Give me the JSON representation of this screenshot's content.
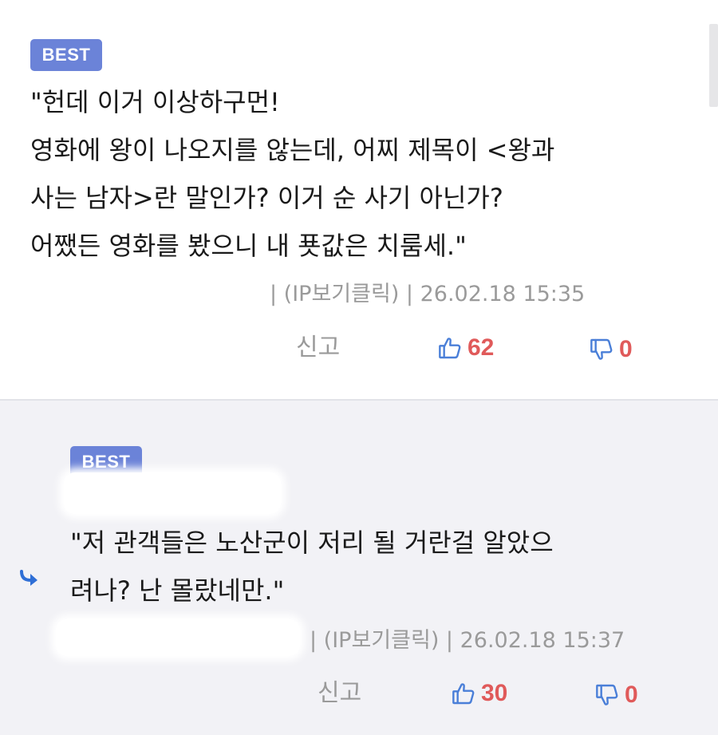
{
  "comments": [
    {
      "badge": "BEST",
      "text": "\"헌데 이거 이상하구먼!\n 영화에 왕이 나오지를 않는데, 어찌 제목이 <왕과\n사는 남자>란 말인가? 이거 순 사기 아닌가?\n 어쨌든 영화를 봤으니 내 푯값은 치룸세.\"",
      "meta": "| (IP보기클릭) | 26.02.18 15:35",
      "report": "신고",
      "likes": "62",
      "dislikes": "0"
    },
    {
      "badge": "BEST",
      "text": "\"저 관객들은 노산군이 저리 될 거란걸 알았으\n려나? 난 몰랐네만.\"",
      "meta": "| (IP보기클릭) | 26.02.18 15:37",
      "report": "신고",
      "likes": "30",
      "dislikes": "0"
    }
  ],
  "icons": {
    "thumbs_up": "thumbs-up-icon",
    "thumbs_down": "thumbs-down-icon",
    "reply": "reply-arrow-icon"
  },
  "colors": {
    "badge": "#6b83d8",
    "vote_count": "#e05a5a",
    "icon_blue": "#4a7fd8",
    "meta_gray": "#9a9a9a",
    "reply_background": "#f2f2f6"
  }
}
